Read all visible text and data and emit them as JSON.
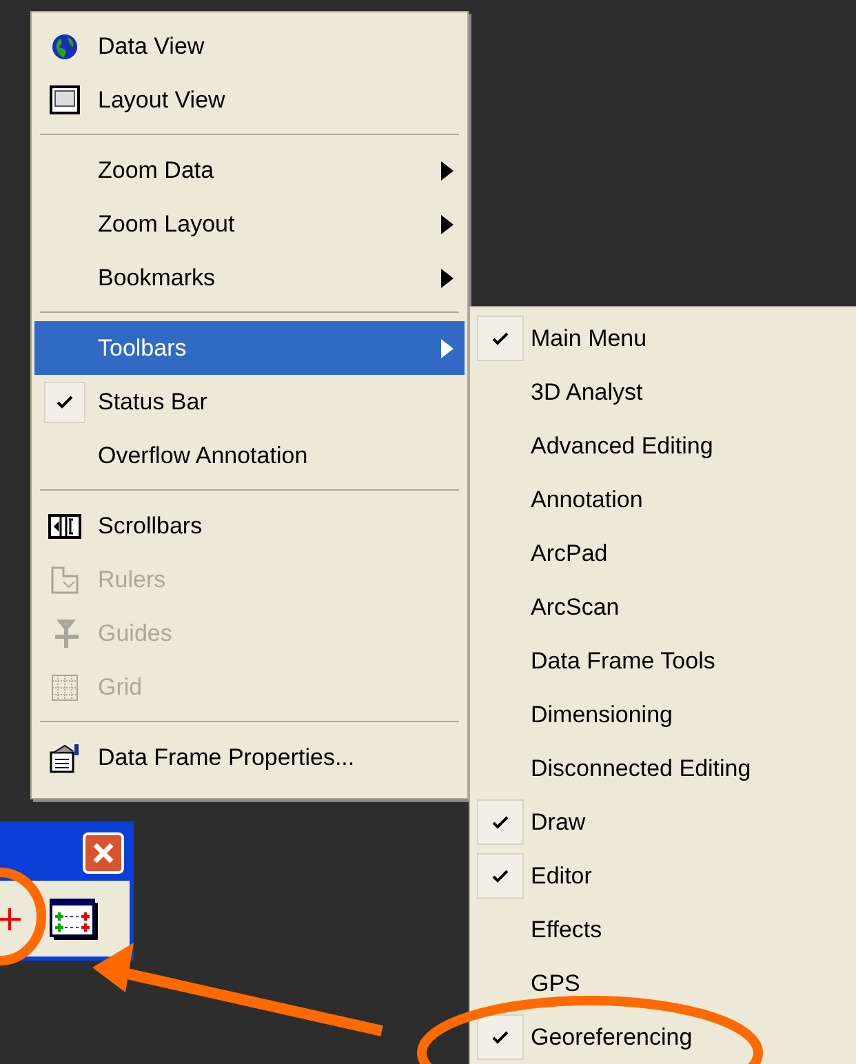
{
  "view_menu": {
    "items": [
      {
        "kind": "globe",
        "label": "Data View",
        "checked": false,
        "disabled": false,
        "selected": false,
        "submenu": false
      },
      {
        "kind": "layout",
        "label": "Layout View",
        "checked": false,
        "disabled": false,
        "selected": false,
        "submenu": false
      },
      {
        "kind": "separator"
      },
      {
        "kind": "plain",
        "label": "Zoom Data",
        "checked": false,
        "disabled": false,
        "selected": false,
        "submenu": true
      },
      {
        "kind": "plain",
        "label": "Zoom Layout",
        "checked": false,
        "disabled": false,
        "selected": false,
        "submenu": true
      },
      {
        "kind": "plain",
        "label": "Bookmarks",
        "checked": false,
        "disabled": false,
        "selected": false,
        "submenu": true
      },
      {
        "kind": "separator"
      },
      {
        "kind": "plain",
        "label": "Toolbars",
        "checked": false,
        "disabled": false,
        "selected": true,
        "submenu": true
      },
      {
        "kind": "plain",
        "label": "Status Bar",
        "checked": true,
        "disabled": false,
        "selected": false,
        "submenu": false
      },
      {
        "kind": "plain",
        "label": "Overflow Annotation",
        "checked": false,
        "disabled": false,
        "selected": false,
        "submenu": false
      },
      {
        "kind": "separator"
      },
      {
        "kind": "scrollbars",
        "label": "Scrollbars",
        "checked": false,
        "disabled": false,
        "selected": false,
        "submenu": false
      },
      {
        "kind": "rulers",
        "label": "Rulers",
        "checked": false,
        "disabled": true,
        "selected": false,
        "submenu": false
      },
      {
        "kind": "guides",
        "label": "Guides",
        "checked": false,
        "disabled": true,
        "selected": false,
        "submenu": false
      },
      {
        "kind": "grid",
        "label": "Grid",
        "checked": false,
        "disabled": true,
        "selected": false,
        "submenu": false
      },
      {
        "kind": "separator"
      },
      {
        "kind": "properties",
        "label": "Data Frame Properties...",
        "checked": false,
        "disabled": false,
        "selected": false,
        "submenu": false
      }
    ]
  },
  "toolbars_submenu": {
    "items": [
      {
        "label": "Main Menu",
        "checked": true
      },
      {
        "label": "3D Analyst",
        "checked": false
      },
      {
        "label": "Advanced Editing",
        "checked": false
      },
      {
        "label": "Annotation",
        "checked": false
      },
      {
        "label": "ArcPad",
        "checked": false
      },
      {
        "label": "ArcScan",
        "checked": false
      },
      {
        "label": "Data Frame Tools",
        "checked": false
      },
      {
        "label": "Dimensioning",
        "checked": false
      },
      {
        "label": "Disconnected Editing",
        "checked": false
      },
      {
        "label": "Draw",
        "checked": true
      },
      {
        "label": "Editor",
        "checked": true
      },
      {
        "label": "Effects",
        "checked": false
      },
      {
        "label": "GPS",
        "checked": false
      },
      {
        "label": "Georeferencing",
        "checked": true
      }
    ]
  }
}
